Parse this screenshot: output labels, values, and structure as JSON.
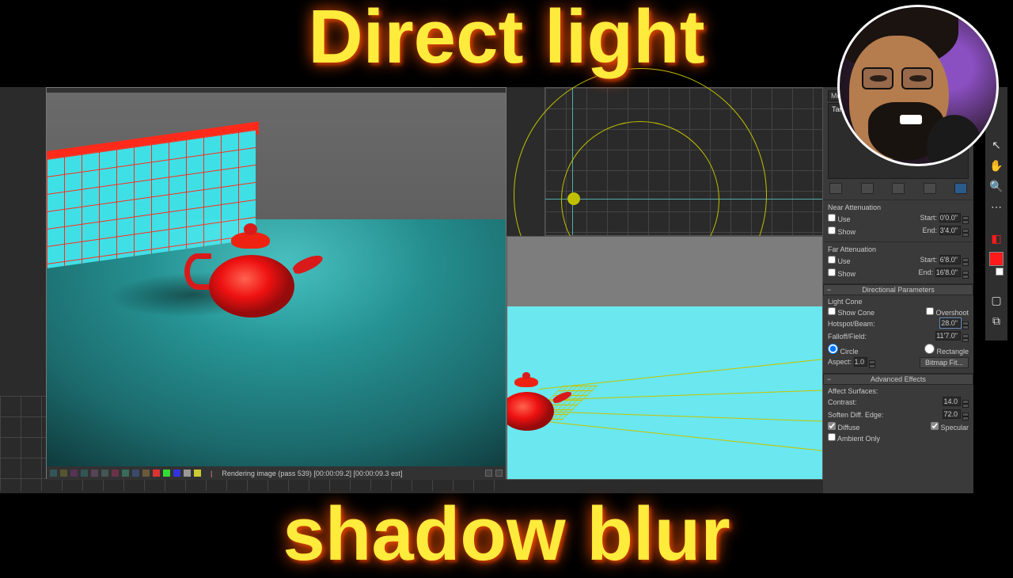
{
  "titles": {
    "top": "Direct  light",
    "bottom": "shadow blur"
  },
  "render_status": {
    "text": "Rendering image (pass 539) [00:00:09.2] [00:00:09.3 est]"
  },
  "panel": {
    "modifier_list_label": "Modifier List",
    "stack_item": "Target Directional",
    "near_atten": {
      "title": "Near Attenuation",
      "use_label": "Use",
      "show_label": "Show",
      "start_label": "Start:",
      "end_label": "End:",
      "start_value": "0'0.0\"",
      "end_value": "3'4.0\""
    },
    "far_atten": {
      "title": "Far Attenuation",
      "use_label": "Use",
      "show_label": "Show",
      "start_label": "Start:",
      "end_label": "End:",
      "start_value": "6'8.0\"",
      "end_value": "16'8.0\""
    },
    "directional": {
      "title": "Directional Parameters",
      "light_cone_label": "Light Cone",
      "show_cone_label": "Show Cone",
      "overshoot_label": "Overshoot",
      "hotspot_label": "Hotspot/Beam:",
      "hotspot_value": "28.0\"",
      "falloff_label": "Falloff/Field:",
      "falloff_value": "11'7.0\"",
      "circle_label": "Circle",
      "rectangle_label": "Rectangle",
      "aspect_label": "Aspect:",
      "aspect_value": "1.0",
      "bitmap_fit_label": "Bitmap Fit..."
    },
    "advanced": {
      "title": "Advanced Effects",
      "affect_surfaces_label": "Affect Surfaces:",
      "contrast_label": "Contrast:",
      "contrast_value": "14.0",
      "soften_label": "Soften Diff. Edge:",
      "soften_value": "72.0",
      "diffuse_label": "Diffuse",
      "specular_label": "Specular",
      "ambient_only_label": "Ambient Only"
    }
  }
}
